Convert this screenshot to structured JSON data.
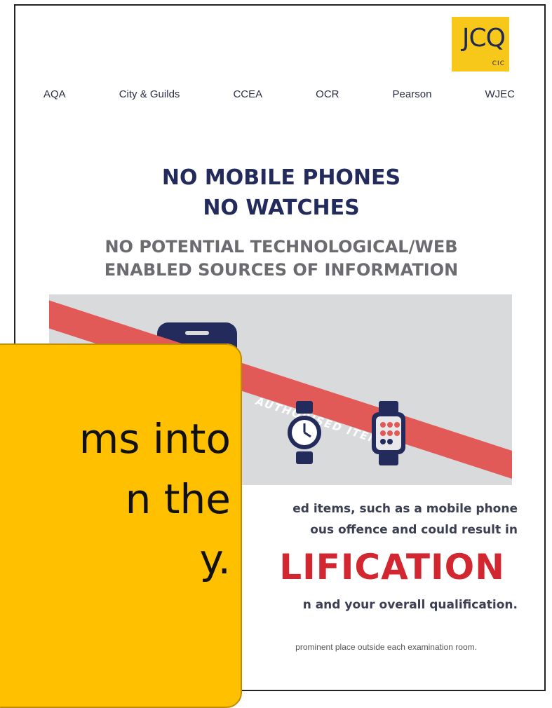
{
  "logo": {
    "main": "JCQ",
    "sub": "CIC"
  },
  "awarding_bodies": [
    "AQA",
    "City & Guilds",
    "CCEA",
    "OCR",
    "Pearson",
    "WJEC"
  ],
  "heading": {
    "line1": "NO MOBILE PHONES",
    "line2": "NO WATCHES"
  },
  "subheading": {
    "line1": "NO POTENTIAL TECHNOLOGICAL/WEB",
    "line2": "ENABLED SOURCES OF INFORMATION"
  },
  "banner": {
    "stripe_text": "AUTHORISED ITEMS",
    "icons": [
      "mobile-phone-icon",
      "analog-watch-icon",
      "smart-watch-icon"
    ]
  },
  "notice": {
    "line1": "ed items, such as a mobile phone",
    "line2": "ous offence and could result in",
    "big_word": "LIFICATION",
    "line3": "n and your overall qualification.",
    "footer": "prominent place outside each examination room."
  },
  "callout": {
    "lines": [
      "ms into",
      "n the",
      "y."
    ]
  },
  "colors": {
    "navy": "#232b5c",
    "grey_text": "#6c6c70",
    "banner_bg": "#d9dadc",
    "stripe_red": "#e25a57",
    "disqualification_red": "#d22630",
    "logo_yellow": "#f7c81a",
    "callout_yellow": "#ffc000"
  }
}
